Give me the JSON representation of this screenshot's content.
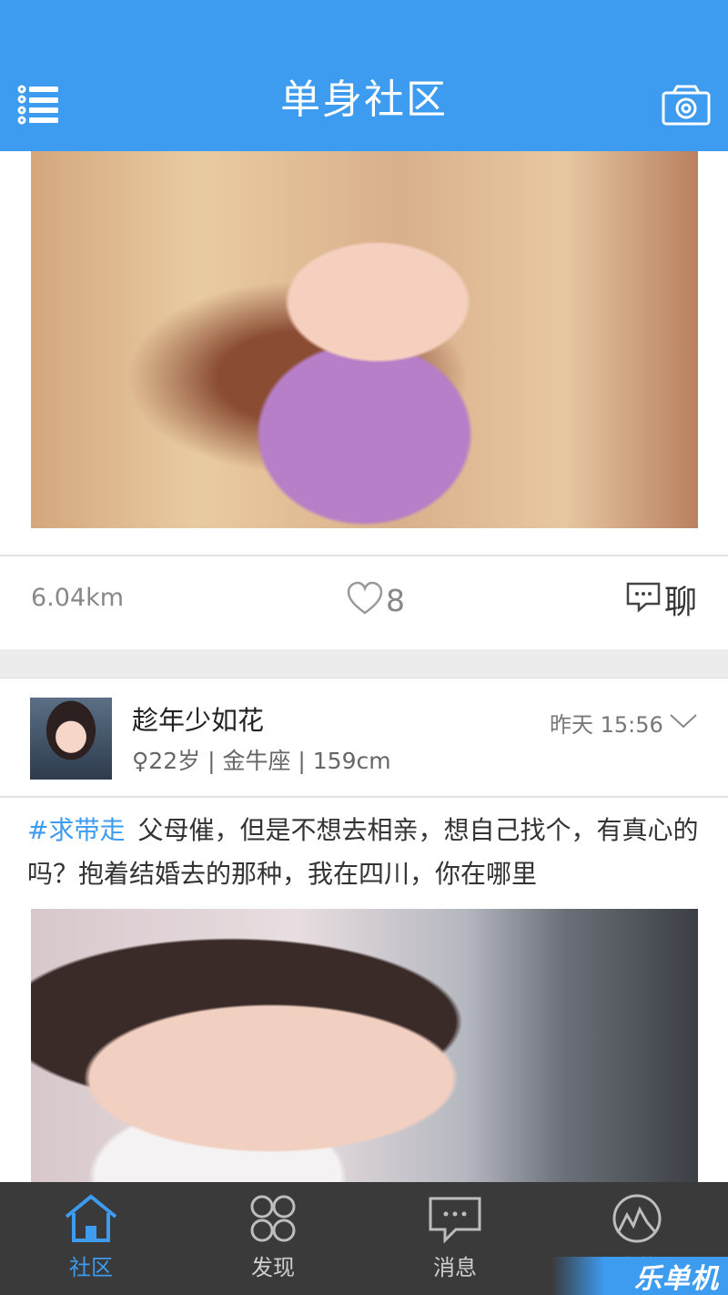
{
  "header": {
    "title": "单身社区",
    "menu_icon": "menu-list-icon",
    "camera_icon": "camera-icon",
    "background_color": "#3d9bf0"
  },
  "posts": [
    {
      "distance": "6.04km",
      "like_count": "8",
      "chat_label": "聊"
    },
    {
      "username": "趁年少如花",
      "user_info": "♀22岁 | 金牛座 | 159cm",
      "time": "昨天 15:56",
      "tag": "#求带走",
      "text": "父母催，但是不想去相亲，想自己找个，有真心的吗？抱着结婚去的那种，我在四川，你在哪里"
    }
  ],
  "tabs": [
    {
      "label": "社区",
      "icon": "home-icon",
      "active": true
    },
    {
      "label": "发现",
      "icon": "discover-icon",
      "active": false
    },
    {
      "label": "消息",
      "icon": "message-icon",
      "active": false
    },
    {
      "label": "我的",
      "icon": "profile-icon",
      "active": false
    }
  ],
  "watermark": "乐单机",
  "colors": {
    "accent": "#3d9bf0",
    "tabbar": "#3a3a3a"
  }
}
